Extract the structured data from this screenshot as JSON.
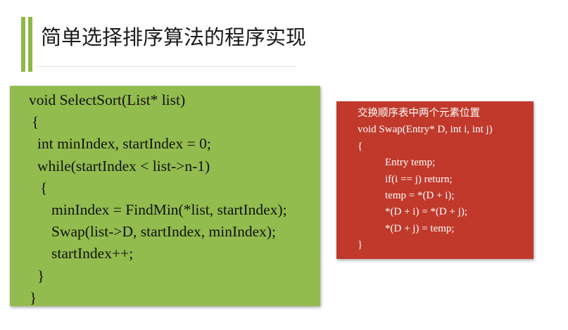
{
  "slide": {
    "title": "简单选择排序算法的程序实现"
  },
  "code_block": {
    "lines": [
      "void SelectSort(List* list)",
      "{",
      "int minIndex, startIndex = 0;",
      "while(startIndex < list->n-1)",
      "{",
      "minIndex = FindMin(*list, startIndex);",
      "Swap(list->D, startIndex, minIndex);",
      "startIndex++;",
      "}",
      "}"
    ]
  },
  "swap_block": {
    "comment": "交换顺序表中两个元素位置",
    "lines": [
      "void Swap(Entry* D, int i, int j)",
      "{",
      "Entry temp;",
      "if(i == j) return;",
      "temp = *(D + i);",
      "*(D + i) = *(D + j);",
      "*(D + j) = temp;",
      "}"
    ]
  },
  "colors": {
    "accent_green": "#8db84a",
    "code_box_bg": "#92bc4e",
    "swap_box_bg": "#c0392b"
  }
}
